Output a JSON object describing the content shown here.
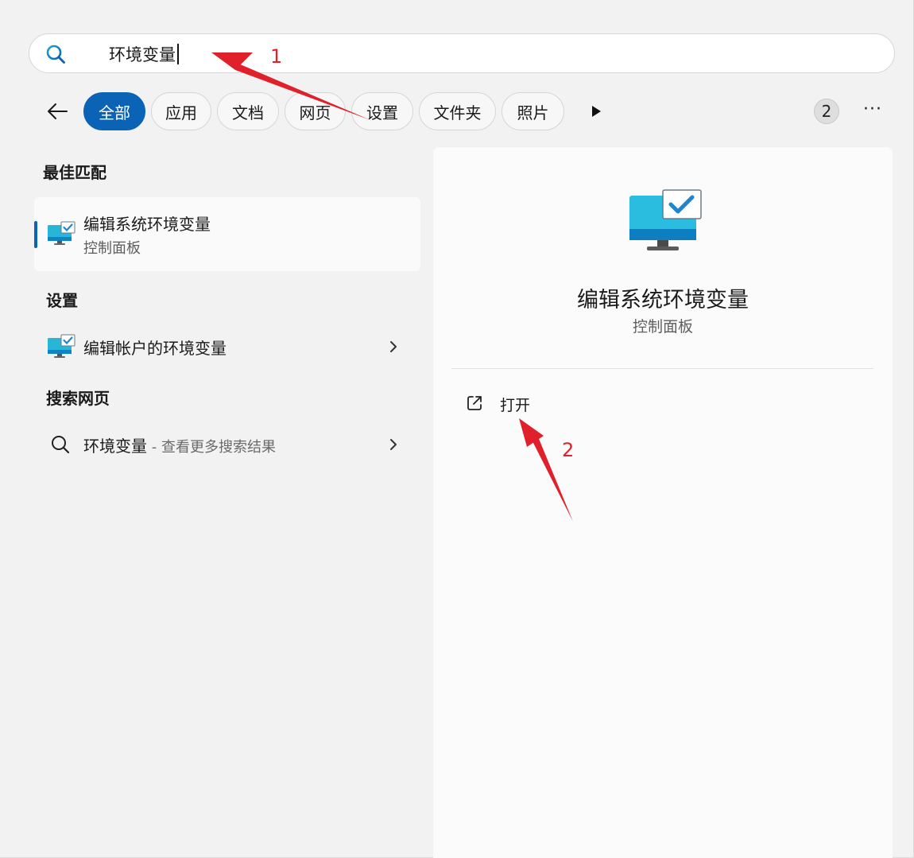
{
  "search": {
    "value": "环境变量"
  },
  "filters": {
    "chips": [
      {
        "label": "全部",
        "active": true
      },
      {
        "label": "应用",
        "active": false
      },
      {
        "label": "文档",
        "active": false
      },
      {
        "label": "网页",
        "active": false
      },
      {
        "label": "设置",
        "active": false
      },
      {
        "label": "文件夹",
        "active": false
      },
      {
        "label": "照片",
        "active": false
      }
    ],
    "count_badge": "2",
    "menu_label": "···"
  },
  "results": {
    "best_match_heading": "最佳匹配",
    "best_match": {
      "title": "编辑系统环境变量",
      "subtitle": "控制面板"
    },
    "settings_heading": "设置",
    "settings_item": {
      "label": "编辑帐户的环境变量"
    },
    "web_heading": "搜索网页",
    "web_item": {
      "label": "环境变量",
      "sub": " - 查看更多搜索结果"
    }
  },
  "detail": {
    "title": "编辑系统环境变量",
    "subtitle": "控制面板",
    "open_label": "打开"
  },
  "annotations": {
    "label_1": "1",
    "label_2": "2",
    "arrow_color": "#e0202a"
  },
  "colors": {
    "accent": "#0a63b5",
    "annotation": "#e0202a"
  }
}
